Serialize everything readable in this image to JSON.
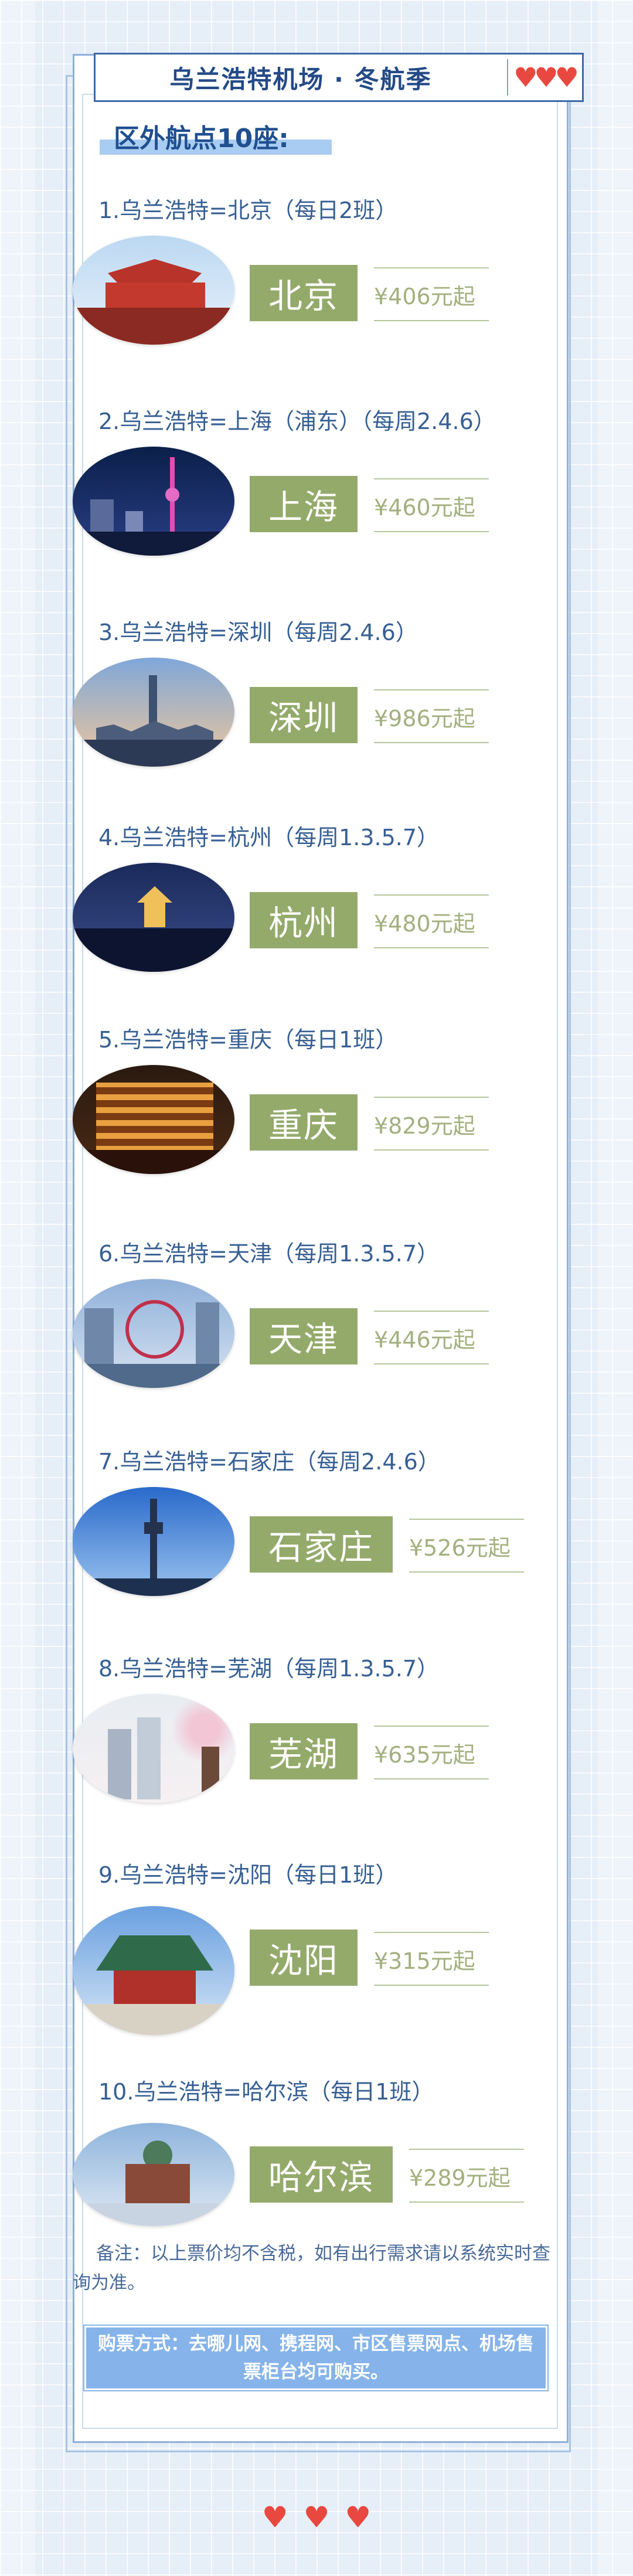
{
  "header": {
    "title": "乌兰浩特机场 · 冬航季",
    "hearts": [
      "heart-icon",
      "heart-icon",
      "heart-icon"
    ],
    "heart_color": "#e8483f"
  },
  "section": {
    "subtitle": "区外航点10座:"
  },
  "routes": [
    {
      "heading": "1.乌兰浩特=北京（每日2班）",
      "city": "北京",
      "price": "¥406元起"
    },
    {
      "heading": "2.乌兰浩特=上海（浦东）（每周2.4.6）",
      "city": "上海",
      "price": "¥460元起"
    },
    {
      "heading": "3.乌兰浩特=深圳（每周2.4.6）",
      "city": "深圳",
      "price": "¥986元起"
    },
    {
      "heading": "4.乌兰浩特=杭州（每周1.3.5.7）",
      "city": "杭州",
      "price": "¥480元起"
    },
    {
      "heading": "5.乌兰浩特=重庆（每日1班）",
      "city": "重庆",
      "price": "¥829元起"
    },
    {
      "heading": "6.乌兰浩特=天津（每周1.3.5.7）",
      "city": "天津",
      "price": "¥446元起"
    },
    {
      "heading": "7.乌兰浩特=石家庄（每周2.4.6）",
      "city": "石家庄",
      "price": "¥526元起"
    },
    {
      "heading": "8.乌兰浩特=芜湖（每周1.3.5.7）",
      "city": "芜湖",
      "price": "¥635元起"
    },
    {
      "heading": "9.乌兰浩特=沈阳（每日1班）",
      "city": "沈阳",
      "price": "¥315元起"
    },
    {
      "heading": "10.乌兰浩特=哈尔滨（每日1班）",
      "city": "哈尔滨",
      "price": "¥289元起"
    }
  ],
  "footer": {
    "note": "备注：以上票价均不含税，如有出行需求请以系统实时查询为准。",
    "purchase": "购票方式：去哪儿网、携程网、市区售票网点、机场售票柜台均可购买。",
    "hearts": [
      "heart-icon",
      "heart-icon",
      "heart-icon"
    ]
  },
  "colors": {
    "accent": "#94aa6b",
    "title": "#234a86",
    "frame": "#8fb0d9"
  }
}
